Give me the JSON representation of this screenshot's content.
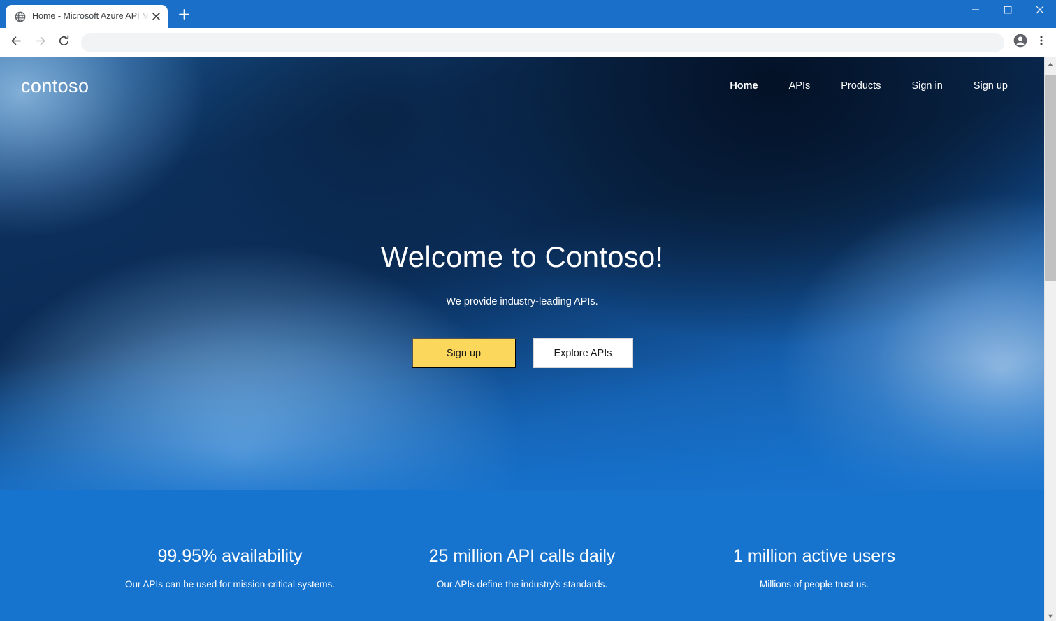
{
  "browser": {
    "tab": {
      "title": "Home - Microsoft Azure API Man",
      "favicon_icon": "globe-icon",
      "close_icon": "close-icon"
    },
    "new_tab_icon": "plus-icon",
    "window_controls": {
      "minimize_icon": "minimize-icon",
      "maximize_icon": "maximize-icon",
      "close_icon": "close-icon"
    },
    "toolbar": {
      "back_icon": "back-arrow-icon",
      "forward_icon": "forward-arrow-icon",
      "reload_icon": "reload-icon",
      "profile_icon": "account-circle-icon",
      "menu_icon": "three-dot-menu-icon",
      "address_value": "",
      "address_placeholder": ""
    },
    "scrollbar": {
      "up_arrow_icon": "scroll-up-arrow-icon",
      "down_arrow_icon": "scroll-down-arrow-icon"
    }
  },
  "site": {
    "logo": "contoso",
    "nav": [
      {
        "label": "Home",
        "active": true
      },
      {
        "label": "APIs",
        "active": false
      },
      {
        "label": "Products",
        "active": false
      },
      {
        "label": "Sign in",
        "active": false
      },
      {
        "label": "Sign up",
        "active": false
      }
    ],
    "hero": {
      "title": "Welcome to Contoso!",
      "subtitle": "We provide industry-leading APIs.",
      "primary_button": "Sign up",
      "secondary_button": "Explore APIs"
    },
    "stats": [
      {
        "value": "99.95% availability",
        "label": "Our APIs can be used for mission-critical systems."
      },
      {
        "value": "25 million API calls daily",
        "label": "Our APIs define the industry's standards."
      },
      {
        "value": "1 million active users",
        "label": "Millions of people trust us."
      }
    ]
  },
  "colors": {
    "browser_frame": "#1a6fc9",
    "accent_yellow": "#fbd75b",
    "page_blue": "#1673ce",
    "hero_dark_navy": "#0b1e36",
    "scrollbar_thumb": "#c1c1c1"
  }
}
